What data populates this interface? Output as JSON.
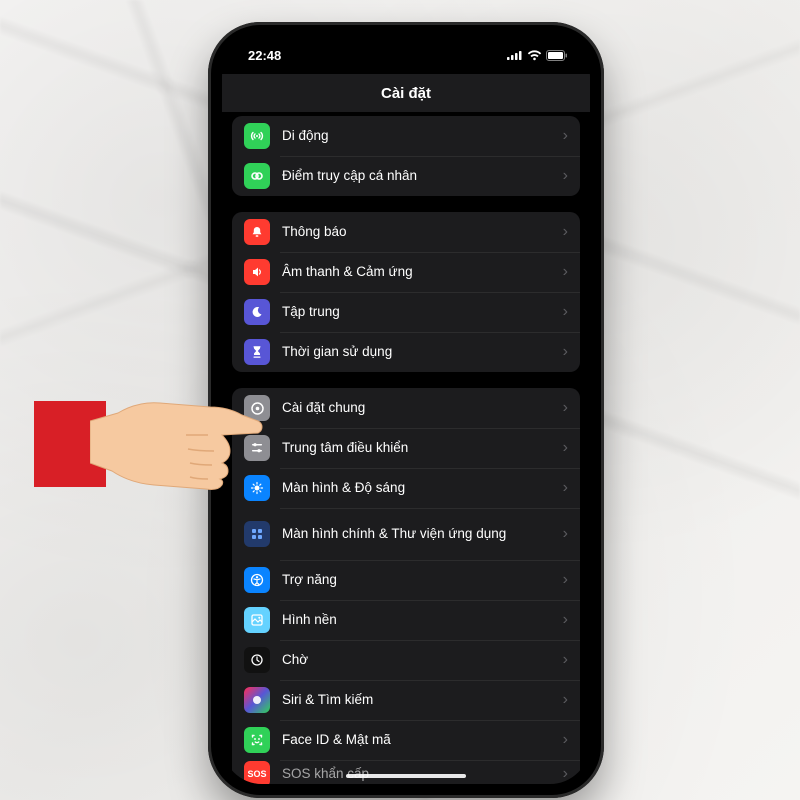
{
  "status": {
    "time": "22:48"
  },
  "navbar": {
    "title": "Cài đặt"
  },
  "group1": {
    "cellular": {
      "label": "Di động"
    },
    "hotspot": {
      "label": "Điểm truy cập cá nhân"
    }
  },
  "group2": {
    "notifications": {
      "label": "Thông báo"
    },
    "sounds": {
      "label": "Âm thanh & Cảm ứng"
    },
    "focus": {
      "label": "Tập trung"
    },
    "screentime": {
      "label": "Thời gian sử dụng"
    }
  },
  "group3": {
    "general": {
      "label": "Cài đặt chung"
    },
    "controlcenter": {
      "label": "Trung tâm điều khiển"
    },
    "display": {
      "label": "Màn hình & Độ sáng"
    },
    "homescreen": {
      "label": "Màn hình chính & Thư viện ứng dụng"
    },
    "accessibility": {
      "label": "Trợ năng"
    },
    "wallpaper": {
      "label": "Hình nền"
    },
    "standby": {
      "label": "Chờ"
    },
    "siri": {
      "label": "Siri & Tìm kiếm"
    },
    "faceid": {
      "label": "Face ID & Mật mã"
    },
    "sos": {
      "label": "SOS khẩn cấp",
      "badge": "SOS"
    }
  }
}
